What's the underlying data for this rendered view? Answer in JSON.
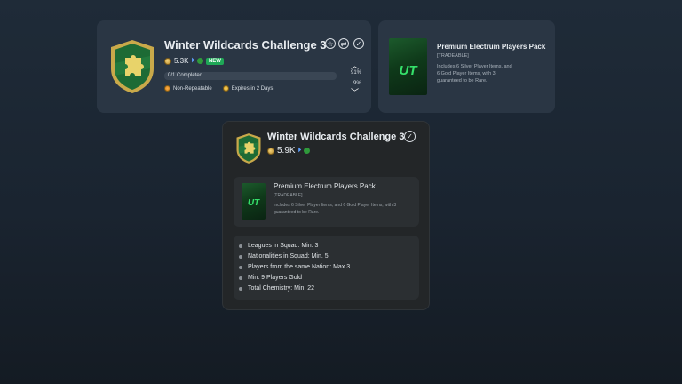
{
  "top_card": {
    "title": "Winter Wildcards Challenge 3",
    "coins": "5.3K",
    "new_badge": "NEW",
    "progress": "0/1 Completed",
    "non_repeatable": "Non-Repeatable",
    "expires": "Expires in 2 Days",
    "vote_up": "91%",
    "vote_down": "9%"
  },
  "reward_card": {
    "title": "Premium Electrum Players Pack",
    "tag": "[TRADEABLE]",
    "desc_line1": "Includes 6 Silver Player Items, and",
    "desc_line2": "6 Gold Player Items, with 3",
    "desc_line3": "guaranteed to be Rare.",
    "pack_logo": "UT"
  },
  "detail": {
    "title": "Winter Wildcards Challenge 3",
    "coins": "5.9K",
    "pack_title": "Premium Electrum Players Pack",
    "pack_tag": "[TRADEABLE]",
    "pack_desc_line1": "Includes 6 Silver Player Items, and 6 Gold Player Items, with 3",
    "pack_desc_line2": "guaranteed to be Rare.",
    "pack_logo": "UT",
    "requirements": [
      "Leagues in Squad: Min. 3",
      "Nationalities in Squad: Min. 5",
      "Players from the same Nation: Max 3",
      "Min. 9 Players Gold",
      "Total Chemistry: Min. 22"
    ]
  },
  "colors": {
    "accent_green": "#35e06a",
    "new_badge": "#1fa857",
    "card_bg": "#2a3644"
  }
}
